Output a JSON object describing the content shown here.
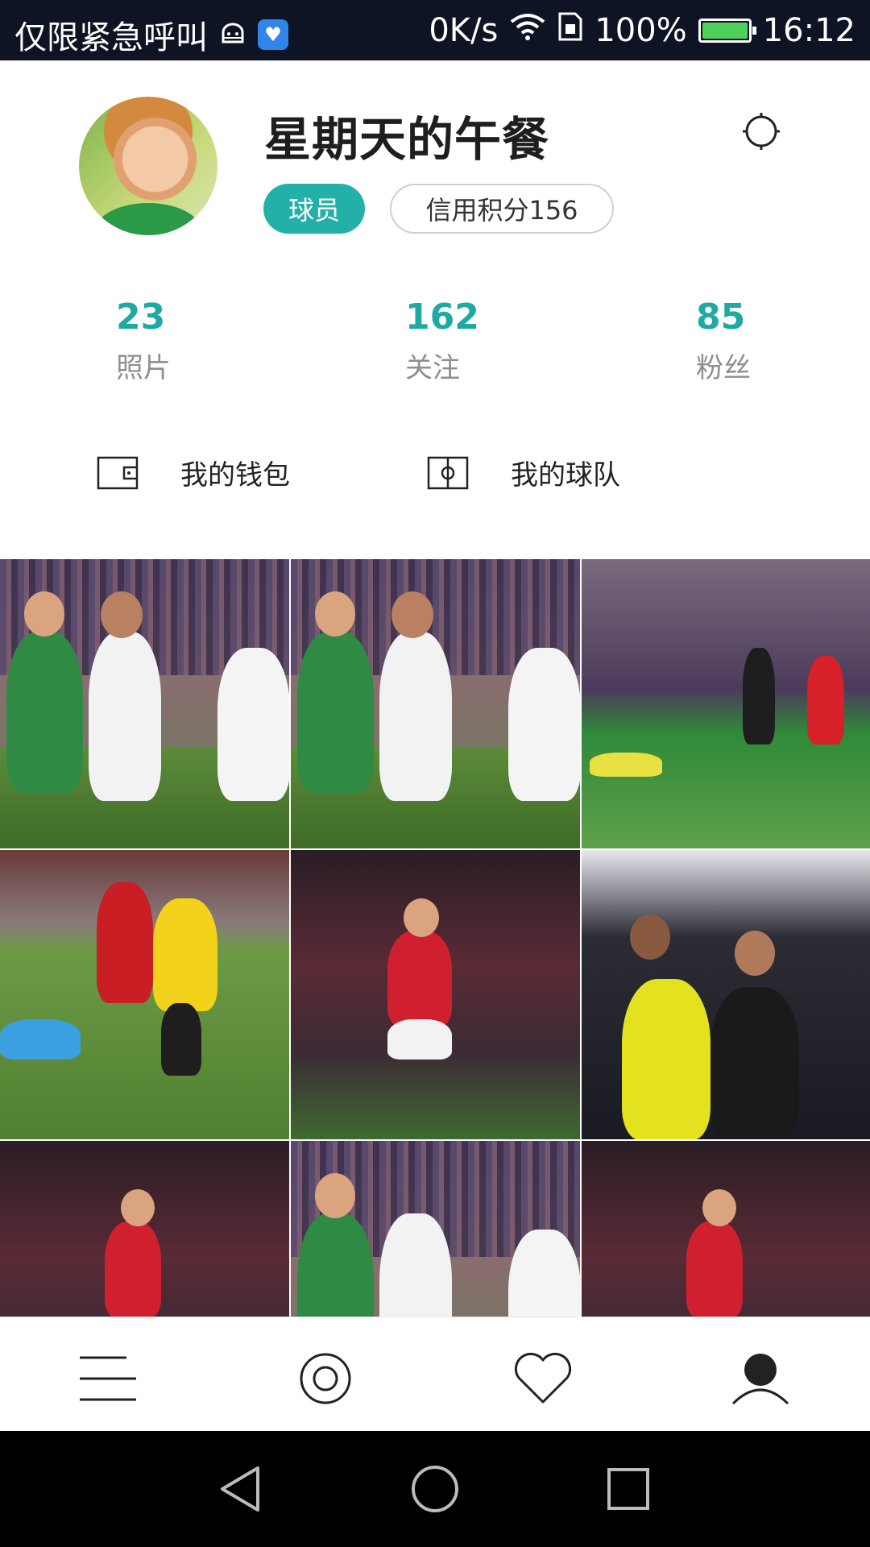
{
  "status_bar": {
    "carrier_text": "仅限紧急呼叫",
    "net_speed": "0K/s",
    "battery_percent": "100%",
    "battery_level": 1.0,
    "time": "16:12",
    "icons": [
      "android-debug-icon",
      "app-notification-icon",
      "wifi-icon",
      "sim-icon",
      "battery-icon"
    ]
  },
  "profile": {
    "username": "星期天的午餐",
    "role_badge": "球员",
    "credit_score": "信用积分156",
    "accent_color": "#23b0a8"
  },
  "stats": [
    {
      "value": "23",
      "label": "照片"
    },
    {
      "value": "162",
      "label": "关注"
    },
    {
      "value": "85",
      "label": "粉丝"
    }
  ],
  "shortcuts": {
    "wallet": "我的钱包",
    "team": "我的球队"
  },
  "photos": [
    {
      "scene": "green-white-players"
    },
    {
      "scene": "green-white-players"
    },
    {
      "scene": "stadium-night-red-player"
    },
    {
      "scene": "red-yellow-players"
    },
    {
      "scene": "red-player-celebrate"
    },
    {
      "scene": "team-celebration"
    },
    {
      "scene": "red-player-celebrate"
    },
    {
      "scene": "green-white-players"
    },
    {
      "scene": "red-player-celebrate"
    }
  ],
  "bottom_nav": [
    {
      "name": "menu",
      "icon": "menu-icon"
    },
    {
      "name": "discover",
      "icon": "camera-target-icon"
    },
    {
      "name": "favorites",
      "icon": "heart-icon"
    },
    {
      "name": "profile",
      "icon": "user-icon"
    }
  ]
}
